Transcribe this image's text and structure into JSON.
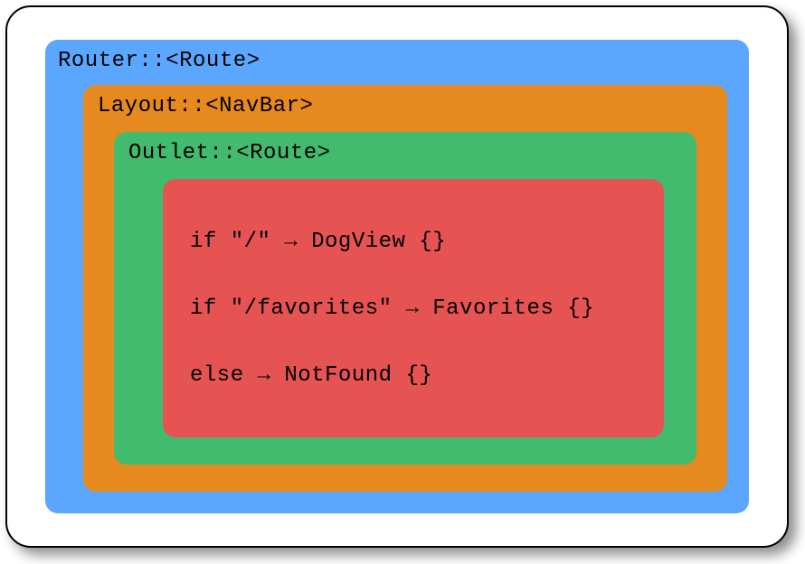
{
  "diagram": {
    "router_label": "Router::<Route>",
    "layout_label": "Layout::<NavBar>",
    "outlet_label": "Outlet::<Route>",
    "routes": [
      "if \"/\" → DogView {}",
      "if \"/favorites\" → Favorites {}",
      "else → NotFound {}"
    ]
  }
}
